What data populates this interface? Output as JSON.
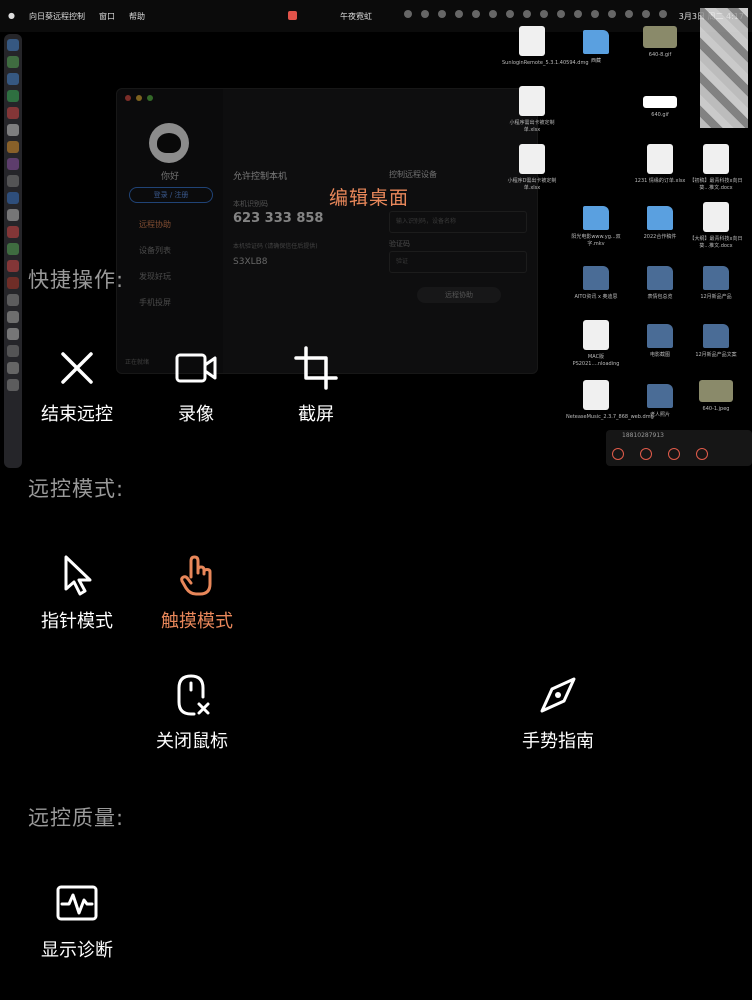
{
  "menubar": {
    "app_name": "向日葵远程控制",
    "menus": [
      "窗口",
      "帮助"
    ],
    "center_text": "午夜霓虹",
    "clock": "3月3日 周二 4:17"
  },
  "remote_window": {
    "greeting": "你好",
    "login_button": "登录 / 注册",
    "nav": [
      "远程协助",
      "设备列表",
      "发现好玩",
      "手机投屏"
    ],
    "allow_title": "允许控制本机",
    "id_label": "本机识别码",
    "id_value": "623 333 858",
    "code_label": "本机验证码 (请确保信任后提供)",
    "code_value": "S3XLB8",
    "control_title": "控制远程设备",
    "id_placeholder": "输入识别码，设备名称",
    "verify_label": "验证码",
    "verify_placeholder": "验证",
    "connect_button": "远程协助",
    "footer": "正在就绪"
  },
  "overlay_title": "编辑桌面",
  "desktop_files": [
    {
      "name": "SunloginRemote_5.3.1.40594.dmg",
      "kind": "doc"
    },
    {
      "name": "西藏",
      "kind": "folder"
    },
    {
      "name": "640-8.gif",
      "kind": "img"
    },
    {
      "name": "小程序需出卡被定制单.xlsx",
      "kind": "doc"
    },
    {
      "name": "640.gif",
      "kind": "white"
    },
    {
      "name": "小程序D需出卡被定制单.xlsx",
      "kind": "doc"
    },
    {
      "name": "1231 情缘的订单.xlsx",
      "kind": "doc"
    },
    {
      "name": "【初稿】最青科技x向日葵...推文.docx",
      "kind": "doc"
    },
    {
      "name": "阳光电影www.yg...双字.mkv",
      "kind": "folder"
    },
    {
      "name": "2022合作稿件",
      "kind": "folder"
    },
    {
      "name": "【大纲】最青科技x向日葵...推文.docx",
      "kind": "doc"
    },
    {
      "name": "AITO资讯 x 奥迪思",
      "kind": "folder-dim"
    },
    {
      "name": "表情包总览",
      "kind": "folder-dim"
    },
    {
      "name": "12月新品产品",
      "kind": "folder-dim"
    },
    {
      "name": "MAC版PS2021....nloading",
      "kind": "doc"
    },
    {
      "name": "电影截图",
      "kind": "folder-dim"
    },
    {
      "name": "12月新品产品文案",
      "kind": "folder-dim"
    },
    {
      "name": "NeteaseMusic_2.3.7_868_web.dmg",
      "kind": "doc"
    },
    {
      "name": "老人照片",
      "kind": "folder-dim"
    },
    {
      "name": "640-1.jpeg",
      "kind": "img"
    }
  ],
  "mini_bar_number": "18810287913",
  "sections": {
    "quick": "快捷操作:",
    "mode": "远控模式:",
    "quality": "远控质量:"
  },
  "actions": {
    "end": "结束远控",
    "record": "录像",
    "screenshot": "截屏",
    "pointer": "指针模式",
    "touch": "触摸模式",
    "close_mouse": "关闭鼠标",
    "gesture": "手势指南",
    "diagnose": "显示诊断"
  },
  "colors": {
    "accent": "#e8875a",
    "background": "#000000",
    "section_text": "#999999"
  }
}
